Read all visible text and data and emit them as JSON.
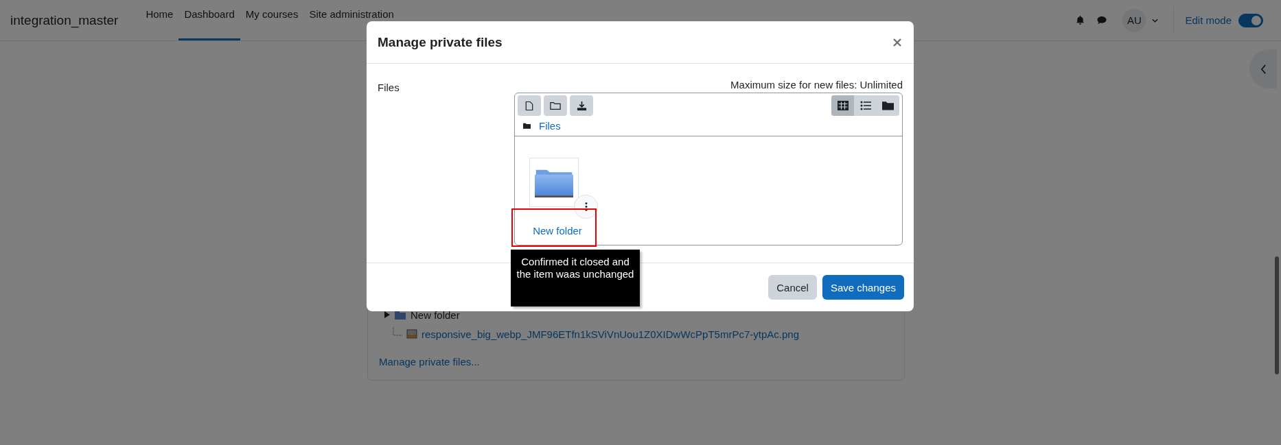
{
  "navbar": {
    "brand": "integration_master",
    "links": [
      {
        "label": "Home",
        "selected": false
      },
      {
        "label": "Dashboard",
        "selected": true
      },
      {
        "label": "My courses",
        "selected": false
      },
      {
        "label": "Site administration",
        "selected": false
      }
    ],
    "avatar": "AU",
    "edit_mode": {
      "label": "Edit mode",
      "on": true
    }
  },
  "private_files": {
    "tree": [
      {
        "kind": "folder",
        "label": "New folder",
        "expanded": false
      },
      {
        "kind": "file",
        "label": "responsive_big_webp_JMF96ETfn1kSViVnUou1Z0XIDwWcPpT5mrPc7-ytpAc.png"
      }
    ],
    "manage_link": "Manage private files..."
  },
  "modal": {
    "title": "Manage private files",
    "field_label": "Files",
    "max_size": "Maximum size for new files: Unlimited",
    "view_modes": [
      {
        "kind": "icons",
        "selected": true
      },
      {
        "kind": "list",
        "selected": false
      },
      {
        "kind": "tree",
        "selected": false
      }
    ],
    "path": "Files",
    "items": [
      {
        "kind": "folder",
        "label": "New folder"
      }
    ],
    "buttons": [
      {
        "label": "Cancel",
        "kind": "secondary"
      },
      {
        "label": "Save changes",
        "kind": "primary"
      }
    ]
  },
  "annotation": {
    "text": "Confirmed it closed and the item waas unchanged"
  }
}
